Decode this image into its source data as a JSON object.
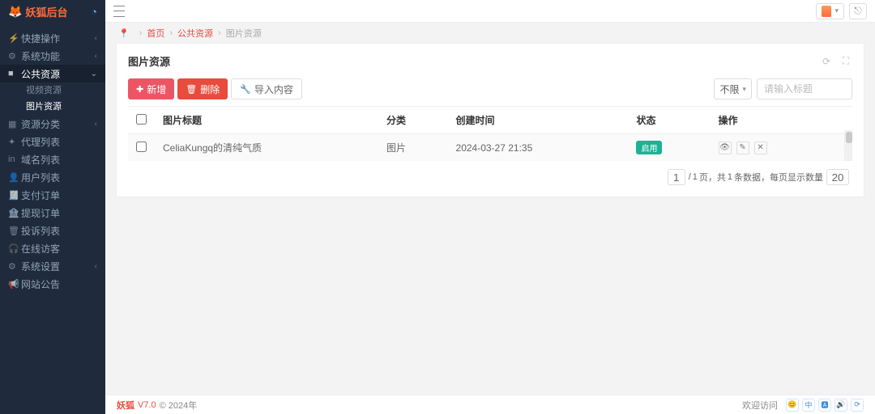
{
  "brand": "妖狐后台",
  "sidebar": {
    "items": [
      {
        "icon": "⚡",
        "label": "快捷操作",
        "chev": "‹"
      },
      {
        "icon": "⚙",
        "label": "系统功能",
        "chev": "‹"
      },
      {
        "icon": "■",
        "label": "公共资源",
        "chev": "⌄",
        "active": true,
        "children": [
          {
            "label": "视频资源",
            "active": false
          },
          {
            "label": "图片资源",
            "active": true
          }
        ]
      },
      {
        "icon": "▦",
        "label": "资源分类",
        "chev": "‹"
      },
      {
        "icon": "✦",
        "label": "代理列表"
      },
      {
        "icon": "in",
        "label": "域名列表"
      },
      {
        "icon": "👤",
        "label": "用户列表"
      },
      {
        "icon": "🧾",
        "label": "支付订单"
      },
      {
        "icon": "🏦",
        "label": "提现订单"
      },
      {
        "icon": "🗑",
        "label": "投诉列表"
      },
      {
        "icon": "🎧",
        "label": "在线访客"
      },
      {
        "icon": "⚙",
        "label": "系统设置",
        "chev": "‹"
      },
      {
        "icon": "📢",
        "label": "网站公告"
      }
    ]
  },
  "breadcrumb": {
    "home": "首页",
    "lvl1": "公共资源",
    "cur": "图片资源"
  },
  "panel": {
    "title": "图片资源"
  },
  "toolbar": {
    "add": "新增",
    "del": "删除",
    "import": "导入内容",
    "filter": "不限",
    "search_placeholder": "请输入标题"
  },
  "table": {
    "headers": [
      "图片标题",
      "分类",
      "创建时间",
      "状态",
      "操作"
    ],
    "rows": [
      {
        "title": "CeliaKungq的清纯气质",
        "category": "图片",
        "created": "2024-03-27 21:35",
        "status": "启用"
      }
    ]
  },
  "pager": {
    "page": "1",
    "total_pages": "1",
    "sep": "/",
    "suffix_pages": "页，共",
    "total_rows": "1",
    "suffix_rows": "条数据，每页显示数量",
    "size": "20"
  },
  "footer": {
    "brand": "妖狐",
    "version": "V7.0",
    "copy": "© 2024年",
    "welcome": "欢迎访问",
    "chips": [
      "😊",
      "中",
      "🅰",
      "🔊",
      "⟳"
    ]
  }
}
